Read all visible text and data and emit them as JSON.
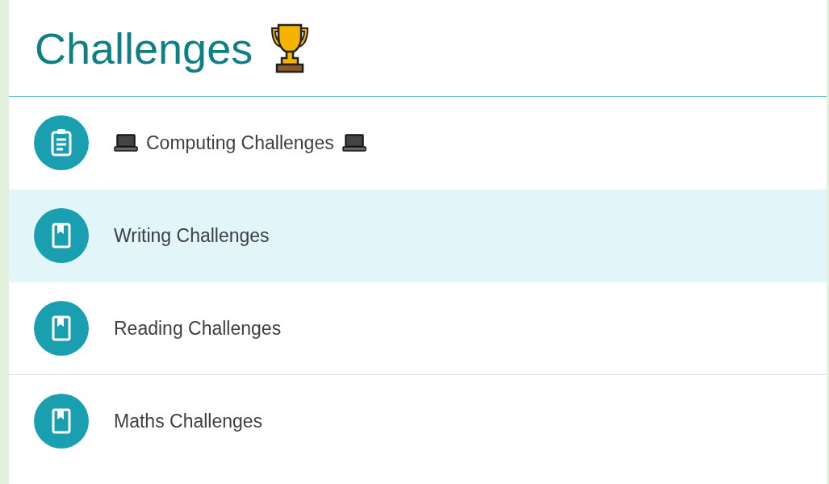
{
  "title": "Challenges",
  "items": [
    {
      "kind": "clipboard",
      "label": "Computing Challenges",
      "decorated": true,
      "selected": false,
      "divider_below": false
    },
    {
      "kind": "book",
      "label": "Writing Challenges",
      "decorated": false,
      "selected": true,
      "divider_below": false
    },
    {
      "kind": "book",
      "label": "Reading Challenges",
      "decorated": false,
      "selected": false,
      "divider_below": true
    },
    {
      "kind": "book",
      "label": "Maths Challenges",
      "decorated": false,
      "selected": false,
      "divider_below": false
    }
  ]
}
